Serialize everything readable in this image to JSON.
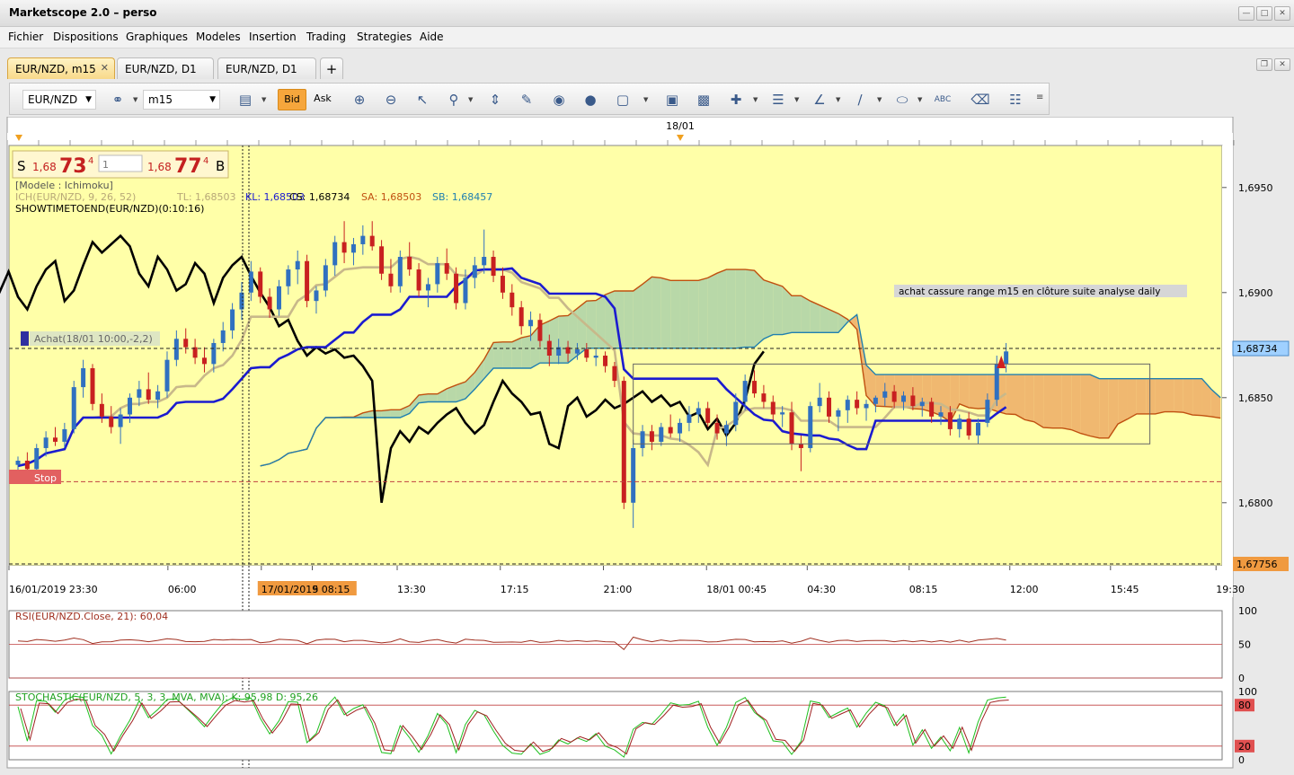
{
  "window": {
    "title": "Marketscope 2.0 – perso"
  },
  "menu": [
    "Fichier",
    "Dispositions",
    "Graphiques",
    "Modeles",
    "Insertion",
    "Trading",
    "Strategies",
    "Aide"
  ],
  "tabs": [
    {
      "label": "EUR/NZD, m15",
      "active": true,
      "closable": true
    },
    {
      "label": "EUR/NZD, D1"
    },
    {
      "label": "EUR/NZD, D1"
    }
  ],
  "toolbar": {
    "instrument": "EUR/NZD",
    "timeframe": "m15",
    "bid_label": "Bid",
    "ask_label": "Ask",
    "icons": [
      "link-icon",
      "chart-style-icon",
      "zoom-in-icon",
      "zoom-out-icon",
      "cursor-icon",
      "zoom-area-icon",
      "fit-icon",
      "properties-icon",
      "eye-icon",
      "globe-icon",
      "ruler-icon",
      "image-icon",
      "print-icon",
      "crosshair-icon",
      "indicator-list-icon",
      "fan-icon",
      "line-tool-icon",
      "ellipse-tool-icon",
      "text-tool-icon",
      "eraser-icon",
      "hierarchy-icon"
    ]
  },
  "chart_data": {
    "type": "candlestick",
    "top_marker": "18/01",
    "price_panel": {
      "sell": {
        "letter": "S",
        "prefix": "1,68",
        "big": "73",
        "sup": "4"
      },
      "buy": {
        "letter": "B",
        "prefix": "1,68",
        "big": "77",
        "sup": "4"
      },
      "amount": "1"
    },
    "info": {
      "model": "[Modele : Ichimoku]",
      "ich": "ICH(EUR/NZD, 9, 26, 52)",
      "tl": "TL: 1,68503",
      "kl": "KL: 1,68503",
      "cs": "CS: 1,68734",
      "sa": "SA: 1,68503",
      "sb": "SB: 1,68457",
      "showtime": "SHOWTIMETOEND(EUR/NZD)(0:10:16)"
    },
    "annotation": "achat cassure range m15 en clôture suite analyse daily",
    "order_label": "Achat(18/01 10:00,-2,2)",
    "stop_label": "Stop",
    "y_range": [
      1.677,
      1.697
    ],
    "y_ticks": [
      1.695,
      1.69,
      1.685,
      1.68
    ],
    "y_tick_labels": [
      "1,6950",
      "1,6900",
      "1,6850",
      "1,6800"
    ],
    "current_price": {
      "value": 1.68734,
      "label": "1,68734"
    },
    "low_price": {
      "value": 1.67756,
      "label": "1,67756"
    },
    "x_labels": [
      "16/01/2019 23:30",
      "06:00",
      "17/01/2019 08:15",
      "5",
      "13:30",
      "17:15",
      "21:00",
      "18/01 00:45",
      "04:30",
      "08:15",
      "12:00",
      "15:45",
      "19:30"
    ],
    "x_label_fracs": [
      0.0,
      0.131,
      0.208,
      0.25,
      0.32,
      0.405,
      0.49,
      0.575,
      0.658,
      0.742,
      0.825,
      0.908,
      0.995
    ],
    "highlight_label_index": 2,
    "candles": [
      [
        1.6818,
        1.6822,
        1.6813,
        1.682
      ],
      [
        1.682,
        1.6824,
        1.6815,
        1.6816
      ],
      [
        1.6816,
        1.6828,
        1.6814,
        1.6826
      ],
      [
        1.6826,
        1.6834,
        1.6822,
        1.6831
      ],
      [
        1.6831,
        1.6836,
        1.6827,
        1.6829
      ],
      [
        1.6829,
        1.6838,
        1.6826,
        1.6835
      ],
      [
        1.6835,
        1.6858,
        1.6833,
        1.6855
      ],
      [
        1.6855,
        1.6868,
        1.685,
        1.6864
      ],
      [
        1.6864,
        1.6866,
        1.6844,
        1.6847
      ],
      [
        1.6847,
        1.6852,
        1.6838,
        1.6841
      ],
      [
        1.6841,
        1.6846,
        1.6833,
        1.6836
      ],
      [
        1.6836,
        1.6845,
        1.6828,
        1.6842
      ],
      [
        1.6842,
        1.6852,
        1.6838,
        1.685
      ],
      [
        1.685,
        1.6858,
        1.6846,
        1.6854
      ],
      [
        1.6854,
        1.6862,
        1.6847,
        1.6849
      ],
      [
        1.6849,
        1.6856,
        1.6845,
        1.6853
      ],
      [
        1.6853,
        1.6872,
        1.685,
        1.6868
      ],
      [
        1.6868,
        1.6882,
        1.6865,
        1.6878
      ],
      [
        1.6878,
        1.6883,
        1.6871,
        1.6874
      ],
      [
        1.6874,
        1.6878,
        1.6866,
        1.6869
      ],
      [
        1.6869,
        1.6874,
        1.6862,
        1.6866
      ],
      [
        1.6866,
        1.6878,
        1.6862,
        1.6876
      ],
      [
        1.6876,
        1.6886,
        1.6872,
        1.6882
      ],
      [
        1.6882,
        1.6895,
        1.6878,
        1.6892
      ],
      [
        1.6892,
        1.6905,
        1.6887,
        1.69
      ],
      [
        1.69,
        1.6915,
        1.6896,
        1.691
      ],
      [
        1.691,
        1.6912,
        1.6895,
        1.6898
      ],
      [
        1.6898,
        1.6902,
        1.6888,
        1.6892
      ],
      [
        1.6892,
        1.6906,
        1.6889,
        1.6903
      ],
      [
        1.6903,
        1.6913,
        1.6899,
        1.6911
      ],
      [
        1.6911,
        1.692,
        1.6904,
        1.6915
      ],
      [
        1.6915,
        1.6918,
        1.6893,
        1.6896
      ],
      [
        1.6896,
        1.6903,
        1.689,
        1.6901
      ],
      [
        1.6901,
        1.6916,
        1.6898,
        1.6913
      ],
      [
        1.6913,
        1.6927,
        1.6908,
        1.6924
      ],
      [
        1.6924,
        1.6934,
        1.6914,
        1.6919
      ],
      [
        1.6919,
        1.6926,
        1.6913,
        1.6923
      ],
      [
        1.6923,
        1.6932,
        1.6918,
        1.6927
      ],
      [
        1.6927,
        1.6934,
        1.692,
        1.6922
      ],
      [
        1.6922,
        1.6925,
        1.6906,
        1.6909
      ],
      [
        1.6909,
        1.6916,
        1.69,
        1.6903
      ],
      [
        1.6903,
        1.692,
        1.69,
        1.6917
      ],
      [
        1.6917,
        1.6924,
        1.6908,
        1.6911
      ],
      [
        1.6911,
        1.6914,
        1.6898,
        1.6901
      ],
      [
        1.6901,
        1.6907,
        1.6893,
        1.6904
      ],
      [
        1.6904,
        1.6917,
        1.69,
        1.6914
      ],
      [
        1.6914,
        1.6921,
        1.6906,
        1.6909
      ],
      [
        1.6909,
        1.6912,
        1.6892,
        1.6895
      ],
      [
        1.6895,
        1.6911,
        1.6892,
        1.6907
      ],
      [
        1.6907,
        1.6917,
        1.6902,
        1.6913
      ],
      [
        1.6913,
        1.693,
        1.6909,
        1.6917
      ],
      [
        1.6917,
        1.692,
        1.6905,
        1.6908
      ],
      [
        1.6908,
        1.6912,
        1.6897,
        1.69
      ],
      [
        1.69,
        1.6904,
        1.6889,
        1.6893
      ],
      [
        1.6893,
        1.6896,
        1.688,
        1.6884
      ],
      [
        1.6884,
        1.6891,
        1.6877,
        1.6887
      ],
      [
        1.6887,
        1.689,
        1.6874,
        1.6877
      ],
      [
        1.6877,
        1.688,
        1.6865,
        1.687
      ],
      [
        1.687,
        1.6878,
        1.6866,
        1.6874
      ],
      [
        1.6874,
        1.6877,
        1.6867,
        1.6871
      ],
      [
        1.6871,
        1.6876,
        1.6868,
        1.6873
      ],
      [
        1.6873,
        1.6876,
        1.6867,
        1.6869
      ],
      [
        1.6869,
        1.6873,
        1.6865,
        1.687
      ],
      [
        1.687,
        1.6872,
        1.6862,
        1.6865
      ],
      [
        1.6865,
        1.6867,
        1.6855,
        1.6858
      ],
      [
        1.6858,
        1.686,
        1.6797,
        1.68
      ],
      [
        1.68,
        1.683,
        1.6788,
        1.6826
      ],
      [
        1.6826,
        1.6837,
        1.6822,
        1.6834
      ],
      [
        1.6834,
        1.6837,
        1.6825,
        1.6829
      ],
      [
        1.6829,
        1.6838,
        1.6827,
        1.6836
      ],
      [
        1.6836,
        1.6842,
        1.6831,
        1.6833
      ],
      [
        1.6833,
        1.684,
        1.6829,
        1.6838
      ],
      [
        1.6838,
        1.6846,
        1.6834,
        1.6842
      ],
      [
        1.6842,
        1.6848,
        1.6838,
        1.6845
      ],
      [
        1.6845,
        1.6848,
        1.6836,
        1.6838
      ],
      [
        1.6838,
        1.6842,
        1.683,
        1.6833
      ],
      [
        1.6833,
        1.6839,
        1.6827,
        1.6837
      ],
      [
        1.6837,
        1.6852,
        1.6834,
        1.6848
      ],
      [
        1.6848,
        1.6861,
        1.6844,
        1.6858
      ],
      [
        1.6858,
        1.6863,
        1.685,
        1.6852
      ],
      [
        1.6852,
        1.6856,
        1.6845,
        1.6848
      ],
      [
        1.6848,
        1.6851,
        1.6839,
        1.6842
      ],
      [
        1.6842,
        1.6846,
        1.6836,
        1.6843
      ],
      [
        1.6843,
        1.6848,
        1.6825,
        1.6828
      ],
      [
        1.6828,
        1.6832,
        1.6815,
        1.6826
      ],
      [
        1.6826,
        1.6848,
        1.6824,
        1.6846
      ],
      [
        1.6846,
        1.6857,
        1.6843,
        1.685
      ],
      [
        1.685,
        1.6853,
        1.6838,
        1.6841
      ],
      [
        1.6841,
        1.6845,
        1.6834,
        1.6844
      ],
      [
        1.6844,
        1.6851,
        1.6838,
        1.6849
      ],
      [
        1.6849,
        1.6853,
        1.6842,
        1.6845
      ],
      [
        1.6845,
        1.6849,
        1.6839,
        1.6847
      ],
      [
        1.6847,
        1.6851,
        1.6843,
        1.685
      ],
      [
        1.685,
        1.6857,
        1.6846,
        1.6853
      ],
      [
        1.6853,
        1.6856,
        1.6845,
        1.6848
      ],
      [
        1.6848,
        1.6853,
        1.6844,
        1.6851
      ],
      [
        1.6851,
        1.6855,
        1.6844,
        1.6846
      ],
      [
        1.6846,
        1.685,
        1.6841,
        1.6848
      ],
      [
        1.6848,
        1.685,
        1.6838,
        1.6841
      ],
      [
        1.6841,
        1.6846,
        1.6837,
        1.6843
      ],
      [
        1.6843,
        1.6846,
        1.6832,
        1.6835
      ],
      [
        1.6835,
        1.6842,
        1.6831,
        1.684
      ],
      [
        1.684,
        1.6843,
        1.683,
        1.6832
      ],
      [
        1.6832,
        1.684,
        1.6828,
        1.6838
      ],
      [
        1.6838,
        1.6852,
        1.6836,
        1.6849
      ],
      [
        1.6849,
        1.687,
        1.6846,
        1.6866
      ],
      [
        1.6866,
        1.6876,
        1.6862,
        1.6872
      ]
    ],
    "ichimoku": {
      "tenkan_name": "TL",
      "kijun_name": "KL",
      "chikou_name": "CS",
      "span_a_name": "SA",
      "span_b_name": "SB"
    },
    "rsi": {
      "label": "RSI(EUR/NZD.Close, 21): 60,04",
      "levels": [
        100,
        50,
        0
      ],
      "level_labels": [
        "100",
        "50",
        "0"
      ]
    },
    "stochastic": {
      "label": "STOCHASTIC(EUR/NZD, 5, 3, 3, MVA, MVA): K: 95,98 D: 95,26",
      "levels": [
        100,
        80,
        20,
        0
      ],
      "level_labels": [
        "100",
        "80",
        "20",
        "0"
      ]
    }
  },
  "colors": {
    "chart_bg": "#ffffa8",
    "up": "#3070c0",
    "down": "#c82020",
    "tenkan": "#c8b88a",
    "kijun": "#1b1bd0",
    "chikou": "#000000",
    "span_a": "#c05010",
    "span_b": "#2080b0",
    "cloud_bull": "#b8d8a8",
    "cloud_bear": "#f0b870",
    "current_price_bg": "#9fd0ff",
    "low_price_bg": "#f09a40"
  }
}
